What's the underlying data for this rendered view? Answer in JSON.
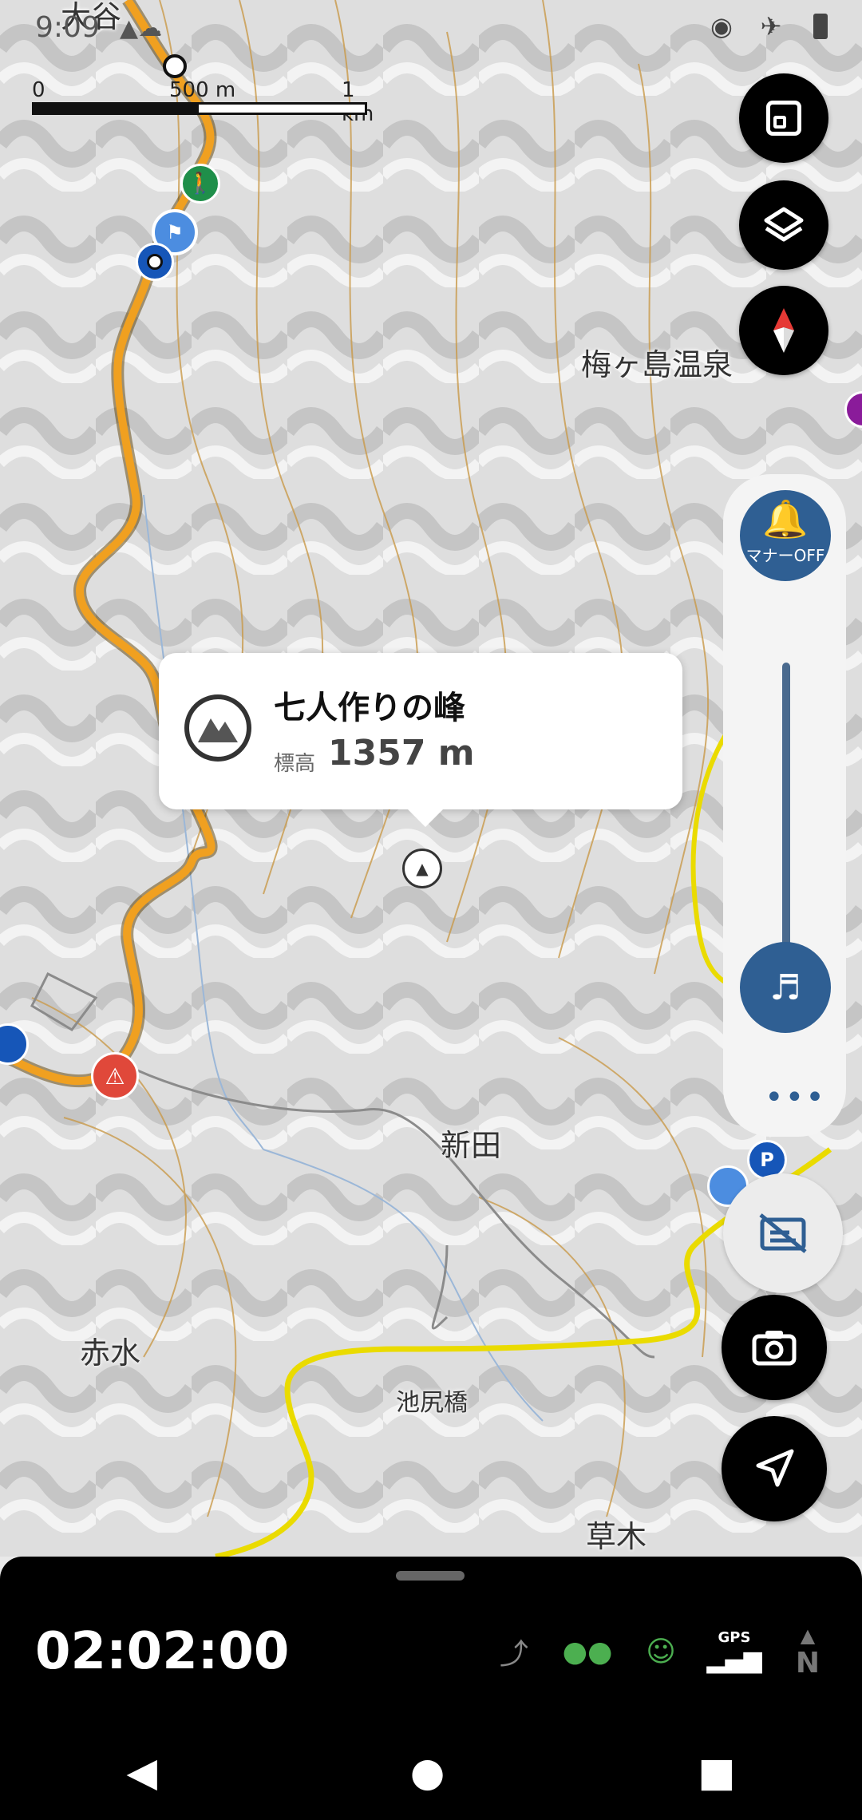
{
  "status_bar": {
    "time": "9:09",
    "icons": [
      "location-icon",
      "airplane-icon",
      "battery-icon"
    ]
  },
  "scale_bar": {
    "label_start": "0",
    "label_mid": "500 m",
    "label_end": "1 km"
  },
  "map": {
    "places": {
      "top_left": "大谷",
      "umegashima": "梅ヶ島温泉",
      "shinden": "新田",
      "akamizu": "赤水",
      "ikejiri": "池尻橋",
      "kusaki": "草木"
    },
    "colors": {
      "trail": "#f0a020",
      "road": "#f2e400",
      "popup_accent": "#2f5f93"
    }
  },
  "popup": {
    "name": "七人作りの峰",
    "elevation_label": "標高",
    "elevation_value": "1357 m"
  },
  "right_controls": {
    "fullscreen_icon": "fullscreen-exit-icon",
    "layers_icon": "layers-icon",
    "compass_icon": "compass-icon"
  },
  "sound_panel": {
    "manner_label": "マナーOFF",
    "more_label": "•••"
  },
  "bottom_panel": {
    "timer": "02:02:00",
    "gps_label": "GPS",
    "north_label": "N"
  }
}
